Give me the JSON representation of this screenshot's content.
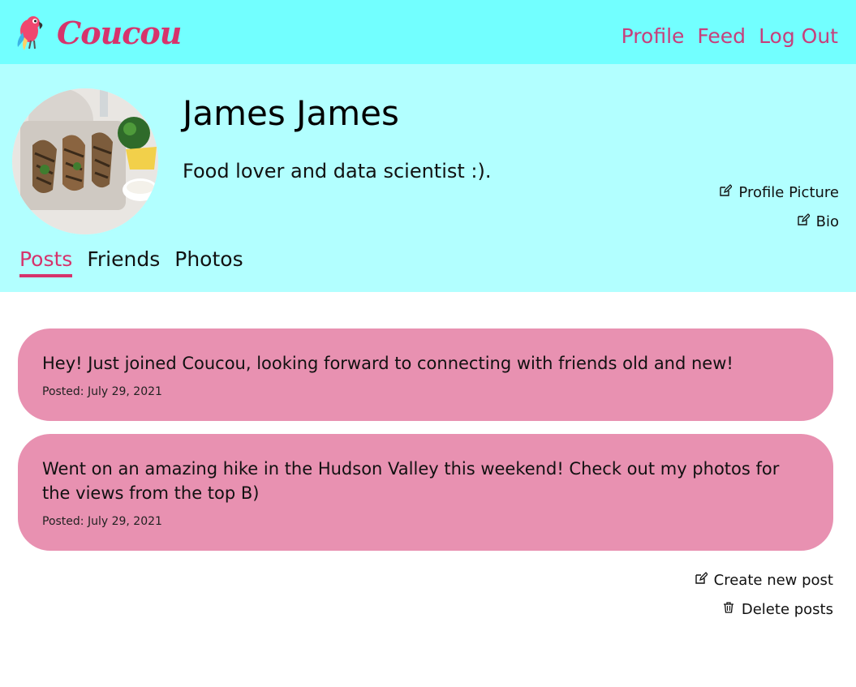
{
  "nav": {
    "brand": "Coucou",
    "links": [
      "Profile",
      "Feed",
      "Log Out"
    ]
  },
  "profile": {
    "name": "James James",
    "bio": "Food lover and data scientist :).",
    "edit_picture_label": "Profile Picture",
    "edit_bio_label": "Bio"
  },
  "tabs": [
    "Posts",
    "Friends",
    "Photos"
  ],
  "posts": [
    {
      "text": "Hey! Just joined Coucou, looking forward to connecting with friends old and new!",
      "date": "Posted: July 29, 2021"
    },
    {
      "text": "Went on an amazing hike in the Hudson Valley this weekend! Check out my photos for the views from the top B)",
      "date": "Posted: July 29, 2021"
    }
  ],
  "actions": {
    "create": "Create new post",
    "delete": "Delete posts"
  },
  "colors": {
    "navbar_bg": "#72ffff",
    "header_bg": "#b2ffff",
    "accent": "#d6336c",
    "post_bg": "#e891b1"
  }
}
